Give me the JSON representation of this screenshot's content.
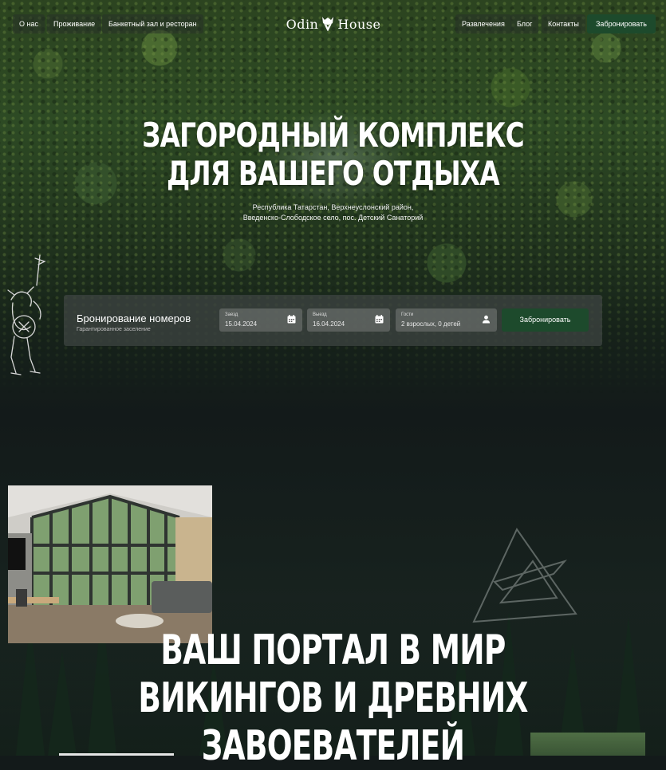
{
  "nav": {
    "left": [
      "О нас",
      "Проживание",
      "Банкетный зал и ресторан"
    ],
    "logo_left": "Odin",
    "logo_right": "House",
    "right": [
      "Развлечения",
      "Блог",
      "Контакты"
    ],
    "cta": "Забронировать"
  },
  "hero": {
    "title_line1": "ЗАГОРОДНЫЙ КОМПЛЕКС",
    "title_line2": "ДЛЯ ВАШЕГО ОТДЫХА",
    "address_line1": "Республика Татарстан, Верхнеуслонский район,",
    "address_line2": "Введенско-Слободское село, пос. Детский Санаторий"
  },
  "booking": {
    "title": "Бронирование номеров",
    "note": "Гарантированное заселение",
    "checkin_label": "Заезд",
    "checkin_value": "15.04.2024",
    "checkout_label": "Выезд",
    "checkout_value": "16.04.2024",
    "guests_label": "Гости",
    "guests_value": "2 взрослых, 0 детей",
    "button": "Забронировать"
  },
  "section": {
    "title_line1": "ВАШ ПОРТАЛ В МИР",
    "title_line2": "ВИКИНГОВ И ДРЕВНИХ",
    "title_line3": "ЗАВОЕВАТЕЛЕЙ"
  },
  "colors": {
    "accent_green": "#1d4a2c",
    "background_dark": "#131a1a"
  }
}
